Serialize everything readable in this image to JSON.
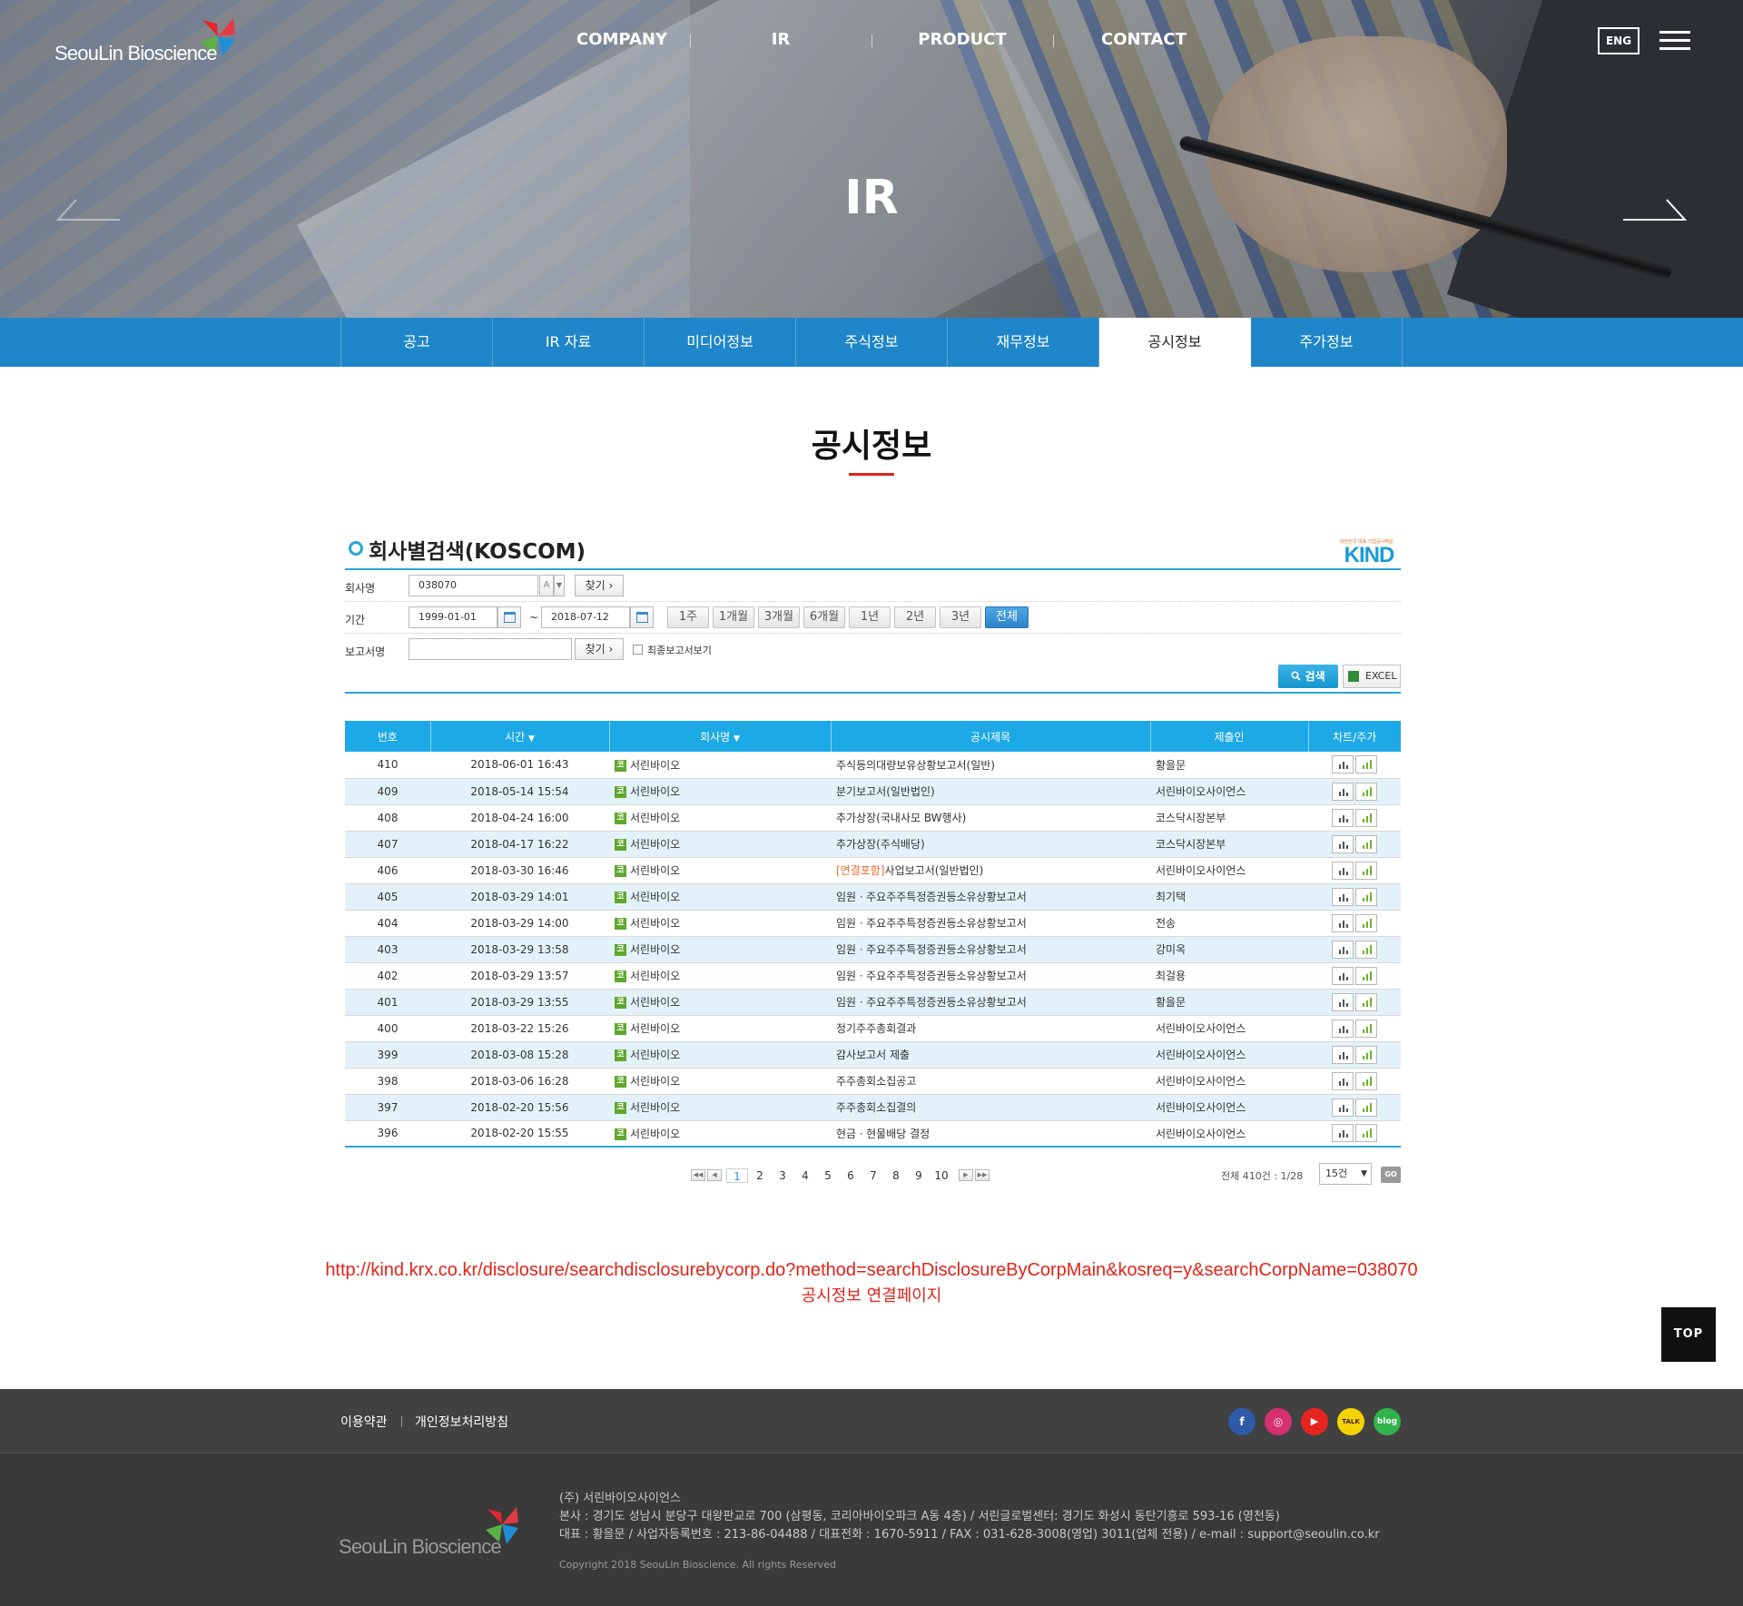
{
  "brand": {
    "logo_text": "SeouLin Bioscience"
  },
  "nav": [
    "COMPANY",
    "IR",
    "PRODUCT",
    "CONTACT"
  ],
  "lang_button": "ENG",
  "hero_title": "IR",
  "subnav": [
    {
      "label": "공고",
      "active": false
    },
    {
      "label": "IR 자료",
      "active": false
    },
    {
      "label": "미디어정보",
      "active": false
    },
    {
      "label": "주식정보",
      "active": false
    },
    {
      "label": "재무정보",
      "active": false
    },
    {
      "label": "공시정보",
      "active": true
    },
    {
      "label": "주가정보",
      "active": false
    }
  ],
  "page_title": "공시정보",
  "kind": {
    "title": "회사별검색(KOSCOM)",
    "logo_text": "KIND",
    "logo_sub": "대한민국 대표 기업공시채널",
    "company_label": "회사명",
    "company_value": "038070",
    "company_toggle": "A",
    "find_label": "찾기",
    "period_label": "기간",
    "date_from": "1999-01-01",
    "date_to": "2018-07-12",
    "tilde": "~",
    "period_buttons": [
      "1주",
      "1개월",
      "3개월",
      "6개월",
      "1년",
      "2년",
      "3년",
      "전체"
    ],
    "period_active": "전체",
    "report_label": "보고서명",
    "report_value": "",
    "final_report_label": "최종보고서보기",
    "search_label": "검색",
    "excel_label": "EXCEL",
    "columns": [
      "번호",
      "시간",
      "회사명",
      "공시제목",
      "제출인",
      "차트/주가"
    ],
    "rows": [
      {
        "no": "410",
        "time": "2018-06-01 16:43",
        "corp": "서린바이오",
        "tag": "",
        "title": "주식등의대량보유상황보고서(일반)",
        "submitter": "황을문"
      },
      {
        "no": "409",
        "time": "2018-05-14 15:54",
        "corp": "서린바이오",
        "tag": "",
        "title": "분기보고서(일반법인)",
        "submitter": "서린바이오사이언스"
      },
      {
        "no": "408",
        "time": "2018-04-24 16:00",
        "corp": "서린바이오",
        "tag": "",
        "title": "추가상장(국내사모 BW행사)",
        "submitter": "코스닥시장본부"
      },
      {
        "no": "407",
        "time": "2018-04-17 16:22",
        "corp": "서린바이오",
        "tag": "",
        "title": "추가상장(주식배당)",
        "submitter": "코스닥시장본부"
      },
      {
        "no": "406",
        "time": "2018-03-30 16:46",
        "corp": "서린바이오",
        "tag": "[연결포함]",
        "title": "사업보고서(일반법인)",
        "submitter": "서린바이오사이언스"
      },
      {
        "no": "405",
        "time": "2018-03-29 14:01",
        "corp": "서린바이오",
        "tag": "",
        "title": "임원ㆍ주요주주특정증권등소유상황보고서",
        "submitter": "최기택"
      },
      {
        "no": "404",
        "time": "2018-03-29 14:00",
        "corp": "서린바이오",
        "tag": "",
        "title": "임원ㆍ주요주주특정증권등소유상황보고서",
        "submitter": "전송"
      },
      {
        "no": "403",
        "time": "2018-03-29 13:58",
        "corp": "서린바이오",
        "tag": "",
        "title": "임원ㆍ주요주주특정증권등소유상황보고서",
        "submitter": "강미옥"
      },
      {
        "no": "402",
        "time": "2018-03-29 13:57",
        "corp": "서린바이오",
        "tag": "",
        "title": "임원ㆍ주요주주특정증권등소유상황보고서",
        "submitter": "최걸용"
      },
      {
        "no": "401",
        "time": "2018-03-29 13:55",
        "corp": "서린바이오",
        "tag": "",
        "title": "임원ㆍ주요주주특정증권등소유상황보고서",
        "submitter": "황을문"
      },
      {
        "no": "400",
        "time": "2018-03-22 15:26",
        "corp": "서린바이오",
        "tag": "",
        "title": "정기주주총회결과",
        "submitter": "서린바이오사이언스"
      },
      {
        "no": "399",
        "time": "2018-03-08 15:28",
        "corp": "서린바이오",
        "tag": "",
        "title": "감사보고서 제출",
        "submitter": "서린바이오사이언스"
      },
      {
        "no": "398",
        "time": "2018-03-06 16:28",
        "corp": "서린바이오",
        "tag": "",
        "title": "주주총회소집공고",
        "submitter": "서린바이오사이언스"
      },
      {
        "no": "397",
        "time": "2018-02-20 15:56",
        "corp": "서린바이오",
        "tag": "",
        "title": "주주총회소집결의",
        "submitter": "서린바이오사이언스"
      },
      {
        "no": "396",
        "time": "2018-02-20 15:55",
        "corp": "서린바이오",
        "tag": "",
        "title": "현금ㆍ현물배당 결정",
        "submitter": "서린바이오사이언스"
      }
    ],
    "corp_icon_glyph": "코",
    "pages": [
      "1",
      "2",
      "3",
      "4",
      "5",
      "6",
      "7",
      "8",
      "9",
      "10"
    ],
    "current_page": "1",
    "total_text": "전체 410건 : 1/28",
    "page_size": "15건",
    "go_label": "GO"
  },
  "link": {
    "url": "http://kind.krx.co.kr/disclosure/searchdisclosurebycorp.do?method=searchDisclosureByCorpMain&kosreq=y&searchCorpName=038070",
    "caption": "공시정보 연결페이지"
  },
  "top_button": "TOP",
  "footer": {
    "links": [
      "이용약관",
      "개인정보처리방침"
    ],
    "social": [
      {
        "name": "facebook",
        "glyph": "f",
        "color": "#2e5aa8"
      },
      {
        "name": "instagram",
        "glyph": "◎",
        "color": "#d6306e"
      },
      {
        "name": "youtube",
        "glyph": "▶",
        "color": "#e52420"
      },
      {
        "name": "kakaotalk",
        "glyph": "TALK",
        "color": "#f5d300"
      },
      {
        "name": "blog",
        "glyph": "blog",
        "color": "#2fb34a"
      }
    ],
    "logo_text": "SeouLin Bioscience",
    "company": "(주) 서린바이오사이언스",
    "address": "본사 : 경기도 성남시 분당구 대왕판교로 700 (삼평동, 코리아바이오파크 A동 4층) / 서린글로벌센터: 경기도 화성시 동탄기흥로 593-16 (영천동)",
    "contact": "대표 : 황을문 / 사업자등록번호 : 213-86-04488 / 대표전화 : 1670-5911 / FAX : 031-628-3008(영업) 3011(업체 전용) / e-mail : support@seoulin.co.kr",
    "copyright": "Copyright 2018 SeouLin Bioscience. All rights Reserved"
  },
  "colors": {
    "primary_blue": "#1f86c9",
    "table_header": "#1da9e6",
    "accent_red": "#e2231a"
  }
}
